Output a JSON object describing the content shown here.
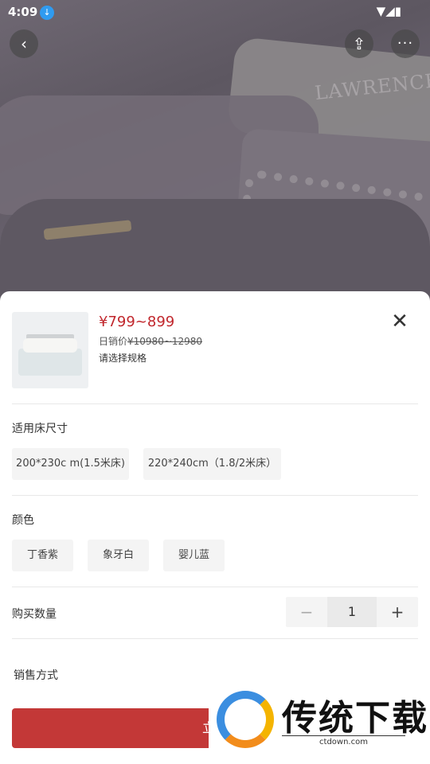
{
  "status": {
    "time": "4:09",
    "icons": "▼◢▮"
  },
  "hero": {
    "pillow_text": "LAWRENCE"
  },
  "nav": {
    "back_glyph": "‹",
    "share_glyph": "⇪",
    "more_glyph": "···"
  },
  "product": {
    "price": "¥799~899",
    "orig_label": "日销价",
    "orig_price": "¥10980~12980",
    "choose_hint": "请选择规格",
    "close_glyph": "✕"
  },
  "sections": {
    "bed_size": {
      "title": "适用床尺寸",
      "options": [
        "200*230c m(1.5米床)",
        "220*240cm（1.8/2米床）"
      ]
    },
    "color": {
      "title": "颜色",
      "options": [
        "丁香紫",
        "象牙白",
        "婴儿蓝"
      ]
    },
    "quantity": {
      "title": "购买数量",
      "value": "1",
      "minus": "−",
      "plus": "+"
    },
    "sales_method": {
      "title": "销售方式"
    }
  },
  "buy_button": {
    "label": "立即"
  },
  "watermark": {
    "title": "传统下载",
    "url": "ctdown.com"
  },
  "colors": {
    "accent": "#c1272d",
    "button": "#c33837"
  }
}
